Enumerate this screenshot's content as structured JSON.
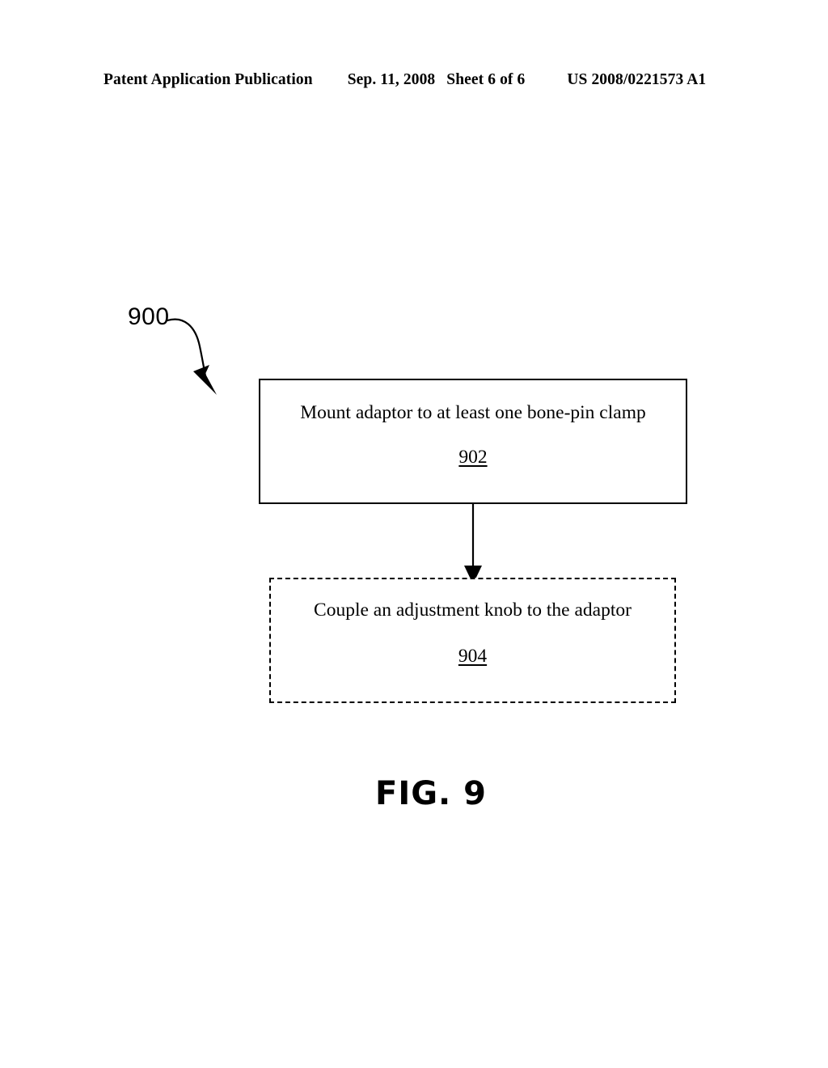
{
  "header": {
    "publication": "Patent Application Publication",
    "date": "Sep. 11, 2008",
    "sheet": "Sheet 6 of 6",
    "patent_number": "US 2008/0221573 A1"
  },
  "figure": {
    "reference_label": "900",
    "caption": "FIG. 9",
    "colors": {
      "ink": "#000000",
      "background": "#ffffff"
    },
    "steps": [
      {
        "text": "Mount adaptor to at least one bone-pin clamp",
        "number": "902",
        "border_style": "solid"
      },
      {
        "text": "Couple an adjustment knob to the adaptor",
        "number": "904",
        "border_style": "dashed"
      }
    ]
  }
}
